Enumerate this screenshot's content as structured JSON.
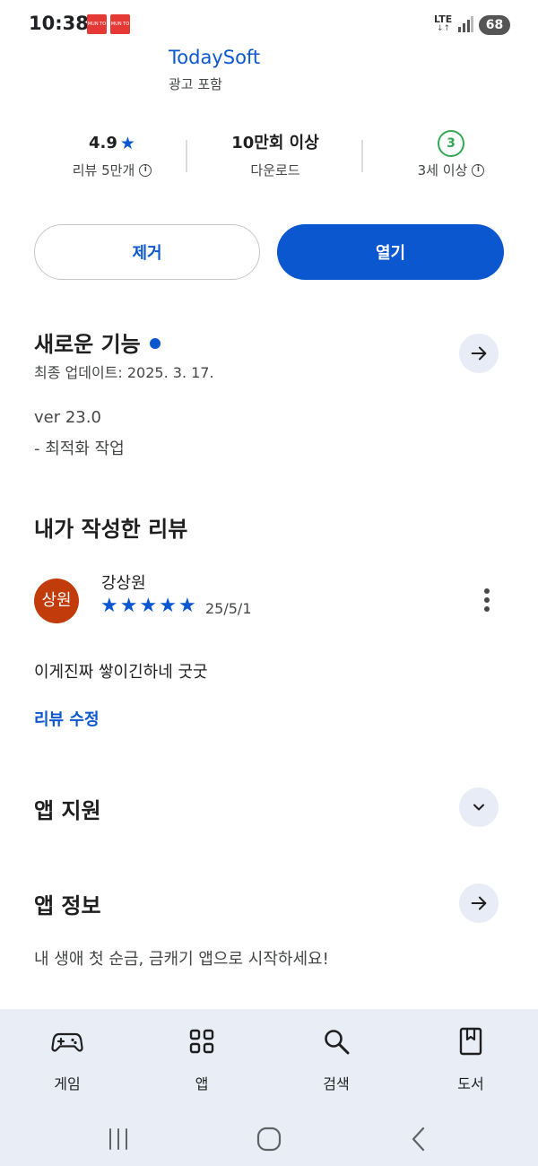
{
  "status_bar": {
    "time": "10:38",
    "notifications": [
      "MUN TO",
      "MUN TO"
    ],
    "network": "LTE",
    "network_arrows": "↓↑",
    "battery": "68"
  },
  "app": {
    "developer": "TodaySoft",
    "ads_note": "광고 포함"
  },
  "stats": {
    "rating": "4.9",
    "reviews": "리뷰 5만개",
    "downloads": "10만회 이상",
    "downloads_label": "다운로드",
    "age_badge": "3",
    "age_label": "3세 이상"
  },
  "actions": {
    "remove_label": "제거",
    "open_label": "열기"
  },
  "whats_new": {
    "title": "새로운 기능",
    "updated": "최종 업데이트: 2025. 3. 17.",
    "version": "ver 23.0",
    "notes": "- 최적화 작업"
  },
  "my_review": {
    "title": "내가 작성한 리뷰",
    "avatar_text": "상원",
    "reviewer": "강상원",
    "stars": 5,
    "date": "25/5/1",
    "text": "이게진짜 쌓이긴하네 굿굿",
    "edit_label": "리뷰 수정"
  },
  "app_support": {
    "title": "앱 지원"
  },
  "app_info": {
    "title": "앱 정보",
    "description": "내 생애 첫 순금, 금캐기 앱으로 시작하세요!"
  },
  "bottom_nav": {
    "games": "게임",
    "apps": "앱",
    "search": "검색",
    "books": "도서"
  },
  "colors": {
    "accent": "#0b57d0",
    "avatar_bg": "#c23b0a",
    "age_badge": "#34a853",
    "nav_bg": "#e9eef6"
  }
}
